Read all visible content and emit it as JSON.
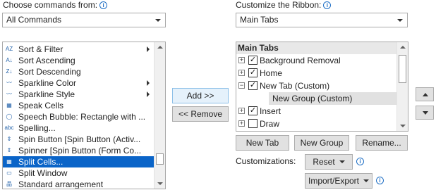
{
  "left": {
    "heading": "Choose commands from:",
    "combo_value": "All Commands",
    "commands": [
      {
        "label": "Sort & Filter",
        "icon": "sort-filter-icon",
        "submenu": true
      },
      {
        "label": "Sort Ascending",
        "icon": "sort-ascending-icon",
        "submenu": false
      },
      {
        "label": "Sort Descending",
        "icon": "sort-descending-icon",
        "submenu": false
      },
      {
        "label": "Sparkline Color",
        "icon": "sparkline-color-icon",
        "submenu": true
      },
      {
        "label": "Sparkline Style",
        "icon": "sparkline-style-icon",
        "submenu": true
      },
      {
        "label": "Speak Cells",
        "icon": "speak-cells-icon",
        "submenu": false
      },
      {
        "label": "Speech Bubble: Rectangle with ...",
        "icon": "speech-bubble-icon",
        "submenu": false
      },
      {
        "label": "Spelling...",
        "icon": "spelling-icon",
        "submenu": false
      },
      {
        "label": "Spin Button [Spin Button (Activ...",
        "icon": "spin-button-icon",
        "submenu": false
      },
      {
        "label": "Spinner [Spin Button (Form Co...",
        "icon": "spinner-icon",
        "submenu": false
      },
      {
        "label": "Split Cells...",
        "icon": "split-cells-icon",
        "submenu": false,
        "selected": true
      },
      {
        "label": "Split Window",
        "icon": "split-window-icon",
        "submenu": false
      },
      {
        "label": "Standard arrangement",
        "icon": "standard-arrangement-icon",
        "submenu": false
      }
    ],
    "scroll_position": 0.9
  },
  "middle": {
    "add_label": "Add >>",
    "remove_label": "<< Remove"
  },
  "right": {
    "heading": "Customize the Ribbon:",
    "combo_value": "Main Tabs",
    "tree_header": "Main Tabs",
    "tree": [
      {
        "label": "Background Removal",
        "expander": "+",
        "checked": true,
        "level": 0
      },
      {
        "label": "Home",
        "expander": "+",
        "checked": true,
        "level": 0
      },
      {
        "label": "New Tab (Custom)",
        "expander": "−",
        "checked": true,
        "level": 0
      },
      {
        "label": "New Group (Custom)",
        "expander": "",
        "checked": null,
        "level": 1,
        "selected": true
      },
      {
        "label": "Insert",
        "expander": "+",
        "checked": true,
        "level": 0
      },
      {
        "label": "Draw",
        "expander": "+",
        "checked": false,
        "level": 0
      }
    ],
    "new_tab_label": "New Tab",
    "new_group_label": "New Group",
    "rename_label": "Rename...",
    "customizations_label": "Customizations:",
    "reset_label": "Reset",
    "import_export_label": "Import/Export"
  },
  "colors": {
    "selection": "#0a64c8",
    "group_selection": "#e1e1e1",
    "info_icon": "#1f6fc5"
  }
}
